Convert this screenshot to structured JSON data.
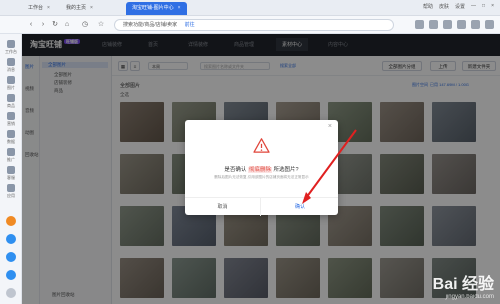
{
  "browser": {
    "tabs": [
      {
        "label": "工作台",
        "active": false
      },
      {
        "label": "我的主页",
        "active": false
      },
      {
        "label": "淘宝旺铺-图片中心",
        "active": true
      }
    ],
    "top_right": [
      "帮助",
      "皮肤",
      "设置"
    ],
    "url_text": "搜索功能/商品/店铺/卖家",
    "url_go": "前往"
  },
  "left_dock": [
    "工作台",
    "消息",
    "图片",
    "商品",
    "营销",
    "数据",
    "推广",
    "客服",
    "应用"
  ],
  "app": {
    "logo": "淘宝旺铺",
    "logo_badge": "旺铺版",
    "menu": [
      "店铺装修",
      "首页",
      "详情装修",
      "商品管理",
      "素材中心",
      "内容中心"
    ],
    "menu_active_index": 4,
    "sub_nav": [
      "图片",
      "视频",
      "音频",
      "动图",
      "回收站"
    ],
    "folders": [
      {
        "label": "全部图片",
        "selected": true
      },
      {
        "label": "全部图片"
      },
      {
        "label": "店铺装修"
      },
      {
        "label": "商品"
      }
    ],
    "folder_footer": "图片回收站",
    "toolbar": {
      "sort": "本周",
      "search_placeholder": "搜索图片名称或文件夹",
      "filter": "搜索全部",
      "btn_move": "全部图片分组",
      "btn_upload": "上传",
      "btn_new_folder": "新建文件夹"
    },
    "breadcrumb": "全部图片",
    "select_all": "全选",
    "storage_used": "已用 147.69M / 1.00G",
    "storage_label": "图片空间"
  },
  "dialog": {
    "title_prefix": "是否确认",
    "highlight": "彻底删除",
    "title_suffix": "所选图片?",
    "subtext": "删除后图片无法恢复,引用该图片的店铺页面将无法正常显示",
    "cancel": "取消",
    "confirm": "确认"
  },
  "watermark": {
    "text": "Bai 经验",
    "url": "jingyan.baidu.com"
  }
}
